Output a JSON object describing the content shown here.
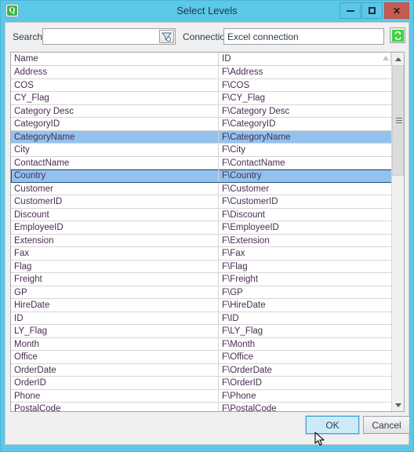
{
  "window": {
    "title": "Select Levels",
    "app_icon": "qlik-q-icon",
    "minimize_label": "Minimize",
    "maximize_label": "Maximize",
    "close_label": "Close",
    "close_glyph": "✕",
    "accent_color": "#5bc8e8",
    "close_color": "#c75b50"
  },
  "toolbar": {
    "search_label": "Search",
    "search_value": "",
    "search_placeholder": "",
    "search_filter_icon": "filter-funnel-icon",
    "connection_label": "Connection",
    "connection_value": "Excel connection",
    "connection_placeholder": "",
    "refresh_icon": "refresh-icon",
    "refresh_color": "#3cc63c"
  },
  "list": {
    "columns": [
      "Name",
      "ID"
    ],
    "sort_indicator": "sort-ascending-icon",
    "rows": [
      {
        "name": "Address",
        "id": "F\\Address",
        "state": "normal"
      },
      {
        "name": "COS",
        "id": "F\\COS",
        "state": "normal"
      },
      {
        "name": "CY_Flag",
        "id": "F\\CY_Flag",
        "state": "normal"
      },
      {
        "name": "Category Desc",
        "id": "F\\Category Desc",
        "state": "normal"
      },
      {
        "name": "CategoryID",
        "id": "F\\CategoryID",
        "state": "normal"
      },
      {
        "name": "CategoryName",
        "id": "F\\CategoryName",
        "state": "selected"
      },
      {
        "name": "City",
        "id": "F\\City",
        "state": "normal"
      },
      {
        "name": "ContactName",
        "id": "F\\ContactName",
        "state": "normal"
      },
      {
        "name": "Country",
        "id": "F\\Country",
        "state": "focused"
      },
      {
        "name": "Customer",
        "id": "F\\Customer",
        "state": "normal"
      },
      {
        "name": "CustomerID",
        "id": "F\\CustomerID",
        "state": "normal"
      },
      {
        "name": "Discount",
        "id": "F\\Discount",
        "state": "normal"
      },
      {
        "name": "EmployeeID",
        "id": "F\\EmployeeID",
        "state": "normal"
      },
      {
        "name": "Extension",
        "id": "F\\Extension",
        "state": "normal"
      },
      {
        "name": "Fax",
        "id": "F\\Fax",
        "state": "normal"
      },
      {
        "name": "Flag",
        "id": "F\\Flag",
        "state": "normal"
      },
      {
        "name": "Freight",
        "id": "F\\Freight",
        "state": "normal"
      },
      {
        "name": "GP",
        "id": "F\\GP",
        "state": "normal"
      },
      {
        "name": "HireDate",
        "id": "F\\HireDate",
        "state": "normal"
      },
      {
        "name": "ID",
        "id": "F\\ID",
        "state": "normal"
      },
      {
        "name": "LY_Flag",
        "id": "F\\LY_Flag",
        "state": "normal"
      },
      {
        "name": "Month",
        "id": "F\\Month",
        "state": "normal"
      },
      {
        "name": "Office",
        "id": "F\\Office",
        "state": "normal"
      },
      {
        "name": "OrderDate",
        "id": "F\\OrderDate",
        "state": "normal"
      },
      {
        "name": "OrderID",
        "id": "F\\OrderID",
        "state": "normal"
      },
      {
        "name": "Phone",
        "id": "F\\Phone",
        "state": "normal"
      },
      {
        "name": "PostalCode",
        "id": "F\\PostalCode",
        "state": "normal"
      }
    ],
    "selection_color": "#93c2ee"
  },
  "scrollbar": {
    "up_icon": "scroll-up-arrow-icon",
    "down_icon": "scroll-down-arrow-icon",
    "thumb": "scrollbar-thumb"
  },
  "footer": {
    "ok_label": "OK",
    "cancel_label": "Cancel"
  }
}
